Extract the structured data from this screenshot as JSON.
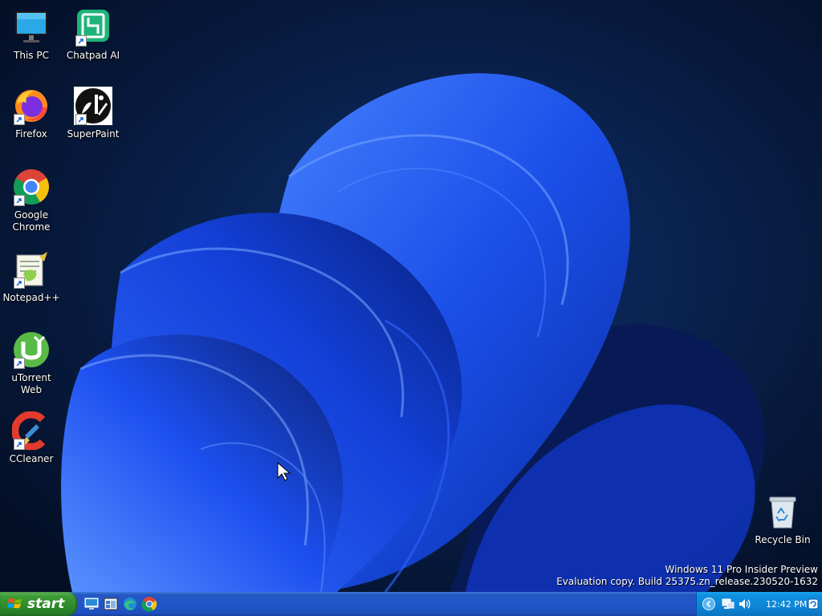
{
  "desktop": {
    "icons": [
      {
        "label": "This PC",
        "icon": "monitor-icon"
      },
      {
        "label": "Chatpad AI",
        "icon": "chatpad-ai-icon"
      },
      {
        "label": "Firefox",
        "icon": "firefox-icon"
      },
      {
        "label": "SuperPaint",
        "icon": "superpaint-icon"
      },
      {
        "label": "Google Chrome",
        "icon": "chrome-icon"
      },
      {
        "label": "Notepad++",
        "icon": "notepadpp-icon"
      },
      {
        "label": "uTorrent Web",
        "icon": "utorrent-icon"
      },
      {
        "label": "CCleaner",
        "icon": "ccleaner-icon"
      },
      {
        "label": "Recycle Bin",
        "icon": "recycle-bin-icon"
      }
    ],
    "watermark": {
      "line1": "Windows 11 Pro Insider Preview",
      "line2": "Evaluation copy. Build 25375.zn_release.230520-1632"
    }
  },
  "taskbar": {
    "start_label": "start",
    "quick_launch": [
      "show-desktop-icon",
      "window-switcher-icon",
      "edge-icon",
      "chrome-icon"
    ],
    "tray": {
      "icons": [
        "chevron-left-icon",
        "network-icon",
        "volume-icon"
      ],
      "clock": "12:42 PM"
    }
  },
  "colors": {
    "taskbar": "#2155c8",
    "start": "#3c9a36",
    "tray": "#0e86d8",
    "wallpaper_bg": "#061a3a",
    "wallpaper_accent": "#1e4ff0"
  }
}
